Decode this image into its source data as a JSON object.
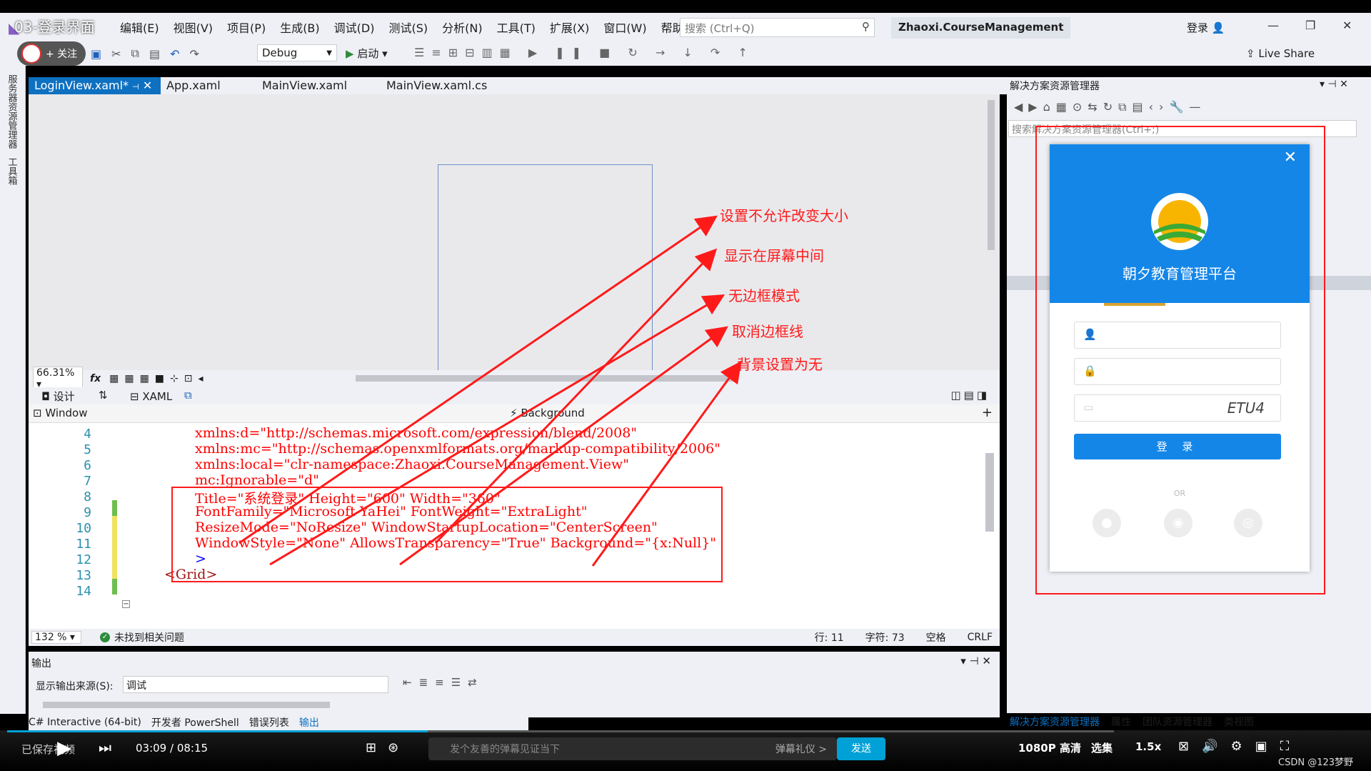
{
  "video": {
    "title": "03-登录界面"
  },
  "menu": [
    "编辑(E)",
    "视图(V)",
    "项目(P)",
    "生成(B)",
    "调试(D)",
    "测试(S)",
    "分析(N)",
    "工具(T)",
    "扩展(X)",
    "窗口(W)",
    "帮助(H)"
  ],
  "search": {
    "placeholder": "搜索 (Ctrl+Q)"
  },
  "project_name": "Zhaoxi.CourseManagement",
  "account": {
    "login": "登录"
  },
  "toolbar": {
    "config": "Debug",
    "start": "启动",
    "live_share": "Live Share",
    "follow": "+ 关注"
  },
  "left_strip": [
    "服务器资源管理器",
    "工具箱"
  ],
  "tabs": [
    "LoginView.xaml*",
    "App.xaml",
    "MainView.xaml",
    "MainView.xaml.cs"
  ],
  "designer": {
    "zoom": "66.31%",
    "design_tab": "设计",
    "xaml_tab": "XAML"
  },
  "navbar": {
    "left": "Window",
    "right": "Background"
  },
  "code": {
    "line_numbers": [
      "4",
      "5",
      "6",
      "7",
      "8",
      "9",
      "10",
      "11",
      "12",
      "13",
      "14"
    ],
    "lines": [
      {
        "text": "xmlns:d=\"http://schemas.microsoft.com/expression/blend/2008\""
      },
      {
        "text": "xmlns:mc=\"http://schemas.openxmlformats.org/markup-compatibility/2006\""
      },
      {
        "text": "xmlns:local=\"clr-namespace:Zhaoxi.CourseManagement.View\""
      },
      {
        "text": "mc:Ignorable=\"d\""
      },
      {
        "text": "Title=\"系统登录\" Height=\"600\" Width=\"360\""
      },
      {
        "text": "FontFamily=\"Microsoft YaHei\" FontWeight=\"ExtraLight\""
      },
      {
        "text": "ResizeMode=\"NoResize\" WindowStartupLocation=\"CenterScreen\""
      },
      {
        "text": "WindowStyle=\"None\" AllowsTransparency=\"True\" Background=\"{x:Null}\""
      },
      {
        "text": ">"
      },
      {
        "text": "<Grid>"
      },
      {
        "text": ""
      }
    ]
  },
  "code_status": {
    "zoom": "132 %",
    "issues": "未找到相关问题",
    "row": "行: 11",
    "col": "字符: 73",
    "space": "空格",
    "eol": "CRLF"
  },
  "output": {
    "title": "输出",
    "source_label": "显示输出来源(S):",
    "source_value": "调试"
  },
  "bottom_tabs": [
    "C# Interactive (64-bit)",
    "开发者 PowerShell",
    "错误列表",
    "输出"
  ],
  "solution": {
    "title": "解决方案资源管理器",
    "search": "搜索解决方案资源管理器(Ctrl+;)",
    "bottom_tabs": [
      "解决方案资源管理器",
      "属性",
      "团队资源管理器",
      "类视图"
    ]
  },
  "annotations": [
    "设置不允许改变大小",
    "显示在屏幕中间",
    "无边框模式",
    "取消边框线",
    "背景设置为无"
  ],
  "login_window": {
    "title": "朝夕教育管理平台",
    "captcha": "ETU4",
    "button": "登 录",
    "or": "OR"
  },
  "player": {
    "save": "已保存视频",
    "time": "03:09 / 08:15",
    "danmaku_placeholder": "发个友善的弹幕见证当下",
    "gift": "弹幕礼仪 >",
    "send": "发送",
    "quality": "1080P 高清",
    "episodes": "选集",
    "speed": "1.5x",
    "watermark": "CSDN @123梦野"
  },
  "colors": {
    "accent": "#0e70c0",
    "annotation": "#ff1a1a",
    "login_blue": "#1486e8"
  }
}
